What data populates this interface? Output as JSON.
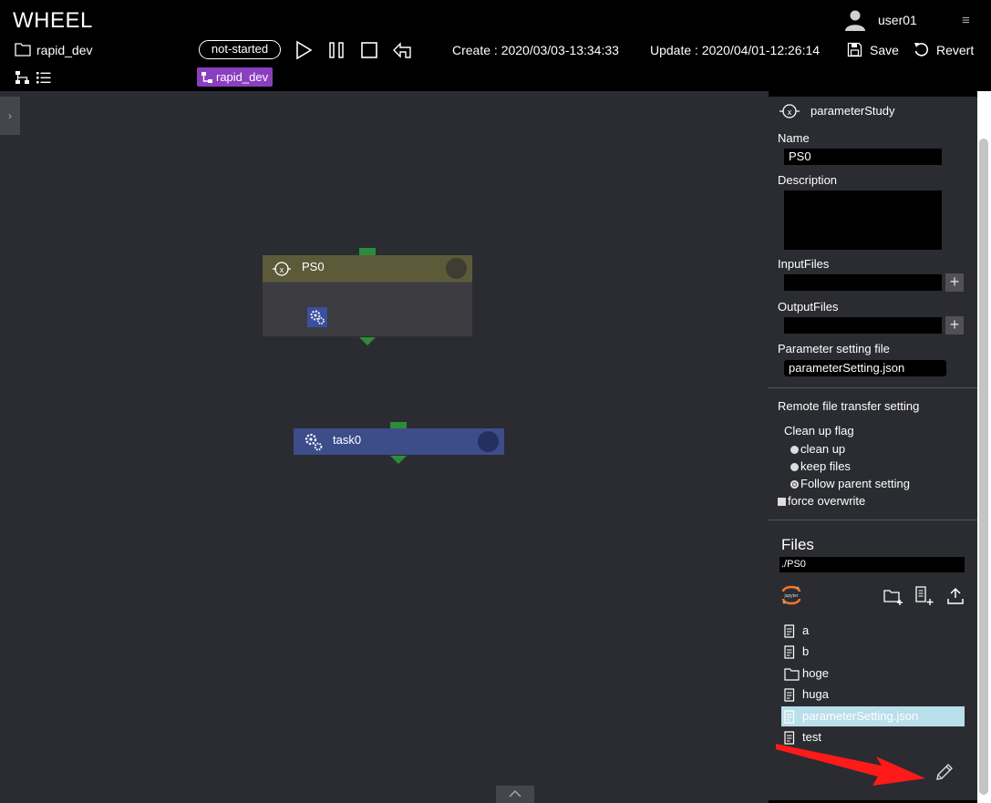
{
  "header": {
    "app_title": "WHEEL",
    "user_name": "user01",
    "project_name": "rapid_dev",
    "status": "not-started",
    "create_label": "Create :  2020/03/03-13:34:33",
    "update_label": "Update :  2020/04/01-12:26:14",
    "save_label": "Save",
    "revert_label": "Revert",
    "breadcrumb": "rapid_dev"
  },
  "canvas": {
    "ps_node": {
      "name": "PS0"
    },
    "task_node": {
      "name": "task0"
    }
  },
  "panel": {
    "component_type": "parameterStudy",
    "name_label": "Name",
    "name_value": "PS0",
    "description_label": "Description",
    "description_value": "",
    "inputfiles_label": "InputFiles",
    "outputfiles_label": "OutputFiles",
    "param_file_label": "Parameter setting file",
    "param_file_value": "parameterSetting.json",
    "remote_label": "Remote file transfer setting",
    "cleanup_label": "Clean up flag",
    "cleanup_options": [
      "clean up",
      "keep files",
      "Follow parent setting"
    ],
    "force_overwrite_label": "force overwrite",
    "files_label": "Files",
    "files_path": "./PS0",
    "files": [
      {
        "name": "a",
        "type": "file"
      },
      {
        "name": "b",
        "type": "file"
      },
      {
        "name": "hoge",
        "type": "folder"
      },
      {
        "name": "huga",
        "type": "file"
      },
      {
        "name": "parameterSetting.json",
        "type": "file"
      },
      {
        "name": "test",
        "type": "file"
      }
    ]
  },
  "colors": {
    "accent_purple": "#8a3fbf",
    "ps_header": "#5d5a3a",
    "task_node": "#3d4d8a",
    "connector_green": "#2e8b3a",
    "selected_file": "#b9dfea",
    "annotation_arrow": "#ff1a1a"
  }
}
